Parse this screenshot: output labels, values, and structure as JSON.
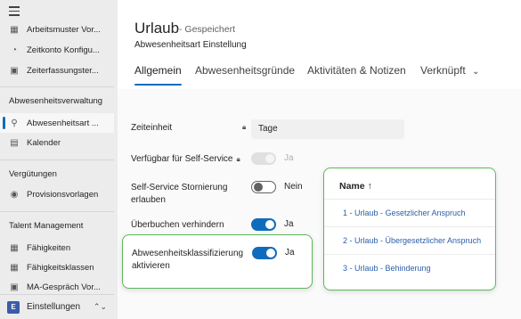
{
  "sidebar": {
    "items_top": [
      {
        "label": "Arbeitsmuster Vor...",
        "icon": "pattern-icon"
      },
      {
        "label": "Zeitkonto Konfigu...",
        "icon": "clock-config-icon"
      },
      {
        "label": "Zeiterfassungster...",
        "icon": "terminal-icon"
      }
    ],
    "groups": [
      {
        "title": "Abwesenheitsverwaltung",
        "items": [
          {
            "label": "Abwesenheitsart ...",
            "icon": "absence-type-icon"
          },
          {
            "label": "Kalender",
            "icon": "calendar-icon"
          }
        ]
      },
      {
        "title": "Vergütungen",
        "items": [
          {
            "label": "Provisionsvorlagen",
            "icon": "commission-icon"
          }
        ]
      },
      {
        "title": "Talent Management",
        "items": [
          {
            "label": "Fähigkeiten",
            "icon": "skills-icon"
          },
          {
            "label": "Fähigkeitsklassen",
            "icon": "skill-classes-icon"
          },
          {
            "label": "MA-Gespräch Vor...",
            "icon": "review-icon"
          }
        ]
      }
    ],
    "bottom": {
      "badge": "E",
      "label": "Einstellungen"
    }
  },
  "header": {
    "title": "Urlaub",
    "status": "- Gespeichert",
    "subtitle": "Abwesenheitsart Einstellung",
    "tabs": [
      {
        "label": "Allgemein",
        "active": true
      },
      {
        "label": "Abwesenheitsgründe",
        "active": false
      },
      {
        "label": "Aktivitäten & Notizen",
        "active": false
      },
      {
        "label": "Verknüpft",
        "active": false
      }
    ]
  },
  "form": {
    "zeiteinheit_label": "Zeiteinheit",
    "zeiteinheit_value": "Tage",
    "self_service_label": "Verfügbar für Self-Service",
    "self_service_value": "Ja",
    "storno_label_1": "Self-Service Stornierung",
    "storno_label_2": "erlauben",
    "storno_value": "Nein",
    "ueberbuchen_label": "Überbuchen verhindern",
    "ueberbuchen_value": "Ja",
    "klass_label_1": "Abwesenheitsklassifizierung",
    "klass_label_2": "aktivieren",
    "klass_value": "Ja"
  },
  "list": {
    "header": "Name ↑",
    "rows": [
      "1 - Urlaub  - Gesetzlicher Anspruch",
      "2 - Urlaub  - Übergesetzlicher Anspruch",
      "3 - Urlaub  - Behinderung"
    ]
  },
  "colors": {
    "accent": "#0f6cbd",
    "highlight": "#5cb85c"
  }
}
